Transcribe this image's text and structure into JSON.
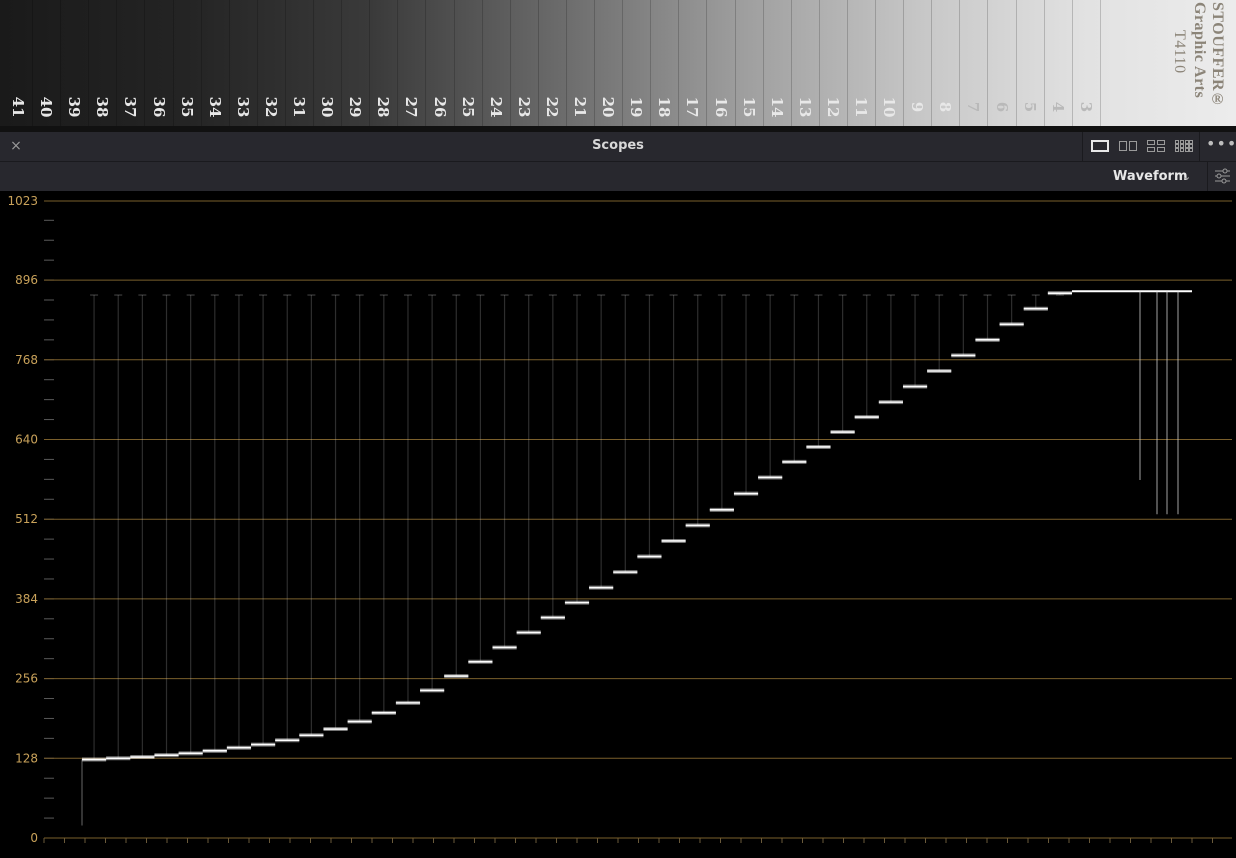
{
  "wedge": {
    "steps": [
      "41",
      "40",
      "39",
      "38",
      "37",
      "36",
      "35",
      "34",
      "33",
      "32",
      "31",
      "30",
      "29",
      "28",
      "27",
      "26",
      "25",
      "24",
      "23",
      "22",
      "21",
      "20",
      "19",
      "18",
      "17",
      "16",
      "15",
      "14",
      "13",
      "12",
      "11",
      "10",
      "9",
      "8",
      "7",
      "6",
      "5",
      "4",
      "3"
    ],
    "brand_line1": "STOUFFER®",
    "brand_line2": "Graphic Arts",
    "brand_line3": "T4110"
  },
  "panel": {
    "close_glyph": "×",
    "title": "Scopes",
    "layout_icons": [
      "single-view-icon",
      "dual-view-icon",
      "quad-view-icon",
      "grid-view-icon"
    ],
    "more_glyph": "•••",
    "scope_type": "Waveform",
    "settings_icon": "sliders-icon"
  },
  "colors": {
    "axis_label": "#c9a25a",
    "graticule": "#7a5f2c",
    "panel_bg": "#28282e",
    "trace": "#ffffff"
  },
  "chart_data": {
    "type": "waveform",
    "ylim": [
      0,
      1023
    ],
    "y_ticks": [
      0,
      128,
      256,
      384,
      512,
      640,
      768,
      896,
      1023
    ],
    "grid": true,
    "step_levels": [
      126,
      128,
      130,
      133,
      136,
      140,
      145,
      150,
      157,
      165,
      175,
      187,
      201,
      217,
      237,
      260,
      283,
      306,
      330,
      354,
      378,
      402,
      427,
      452,
      477,
      502,
      527,
      553,
      579,
      604,
      628,
      652,
      676,
      700,
      725,
      750,
      775,
      800,
      825,
      850,
      875
    ],
    "highlight_level": 878,
    "highlight_dip_level": 520
  }
}
